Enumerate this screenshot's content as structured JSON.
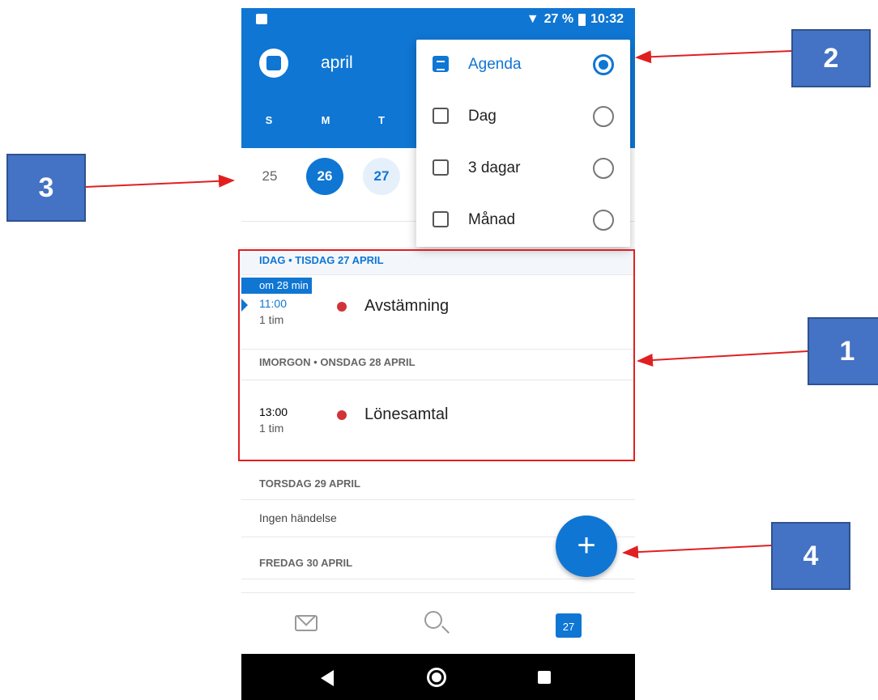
{
  "status_bar": {
    "signal": "27 %",
    "time": "10:32"
  },
  "header": {
    "month": "april"
  },
  "weekdays": [
    "S",
    "M",
    "T"
  ],
  "dates": [
    "25",
    "26",
    "27"
  ],
  "view_menu": {
    "items": [
      {
        "label": "Agenda",
        "selected": true
      },
      {
        "label": "Dag",
        "selected": false
      },
      {
        "label": "3 dagar",
        "selected": false
      },
      {
        "label": "Månad",
        "selected": false
      }
    ]
  },
  "agenda": {
    "today_header": "IDAG • TISDAG 27 APRIL",
    "soon_label": "om 28 min",
    "event1": {
      "time": "11:00",
      "duration": "1 tim",
      "title": "Avstämning"
    },
    "tomorrow_header": "IMORGON • ONSDAG 28 APRIL",
    "event2": {
      "time": "13:00",
      "duration": "1 tim",
      "title": "Lönesamtal"
    },
    "thursday_header": "TORSDAG 29 APRIL",
    "no_event": "Ingen händelse",
    "friday_header": "FREDAG 30 APRIL"
  },
  "fab": {
    "icon": "+"
  },
  "bottom_nav": {
    "calendar_day": "27"
  },
  "callouts": [
    "1",
    "2",
    "3",
    "4"
  ],
  "colors": {
    "accent": "#0f76d3",
    "event_dot": "#d13438",
    "callout": "#4472c4",
    "annotation": "#e02020"
  }
}
